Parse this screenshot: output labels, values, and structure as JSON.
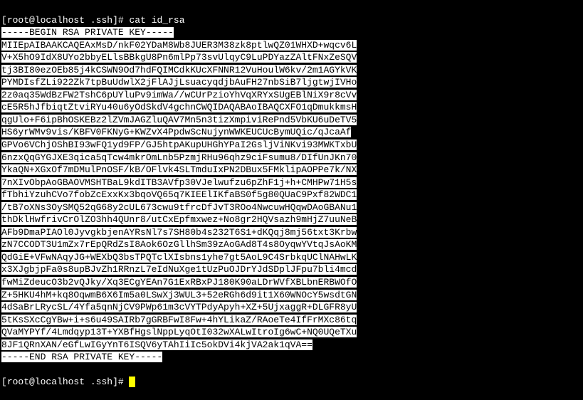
{
  "prompt1": {
    "bracket_open": "[",
    "user_host": "root@localhost",
    "path": ".ssh",
    "bracket_close": "]#",
    "command": "cat id_rsa"
  },
  "key": {
    "begin": "-----BEGIN RSA PRIVATE KEY-----",
    "lines": [
      "MIIEpAIBAAKCAQEAxMsD/nkF02YDaM8Wb8JUER3M38zk8ptlwQZ01WHXD+wqcv6L",
      "V+X5hO9IdX8UYo2bbyELlsBBkgU8Pn6mlPp73svUlqyC9LuPDYazZAltFNxZeSQV",
      "tj3BI80ezOEb85j4kCSWN9Od7hdFQIMCdkKUcXFNNR12VuHoulW6kv/2m1AGYkVK",
      "PYMDIsfZLi922Zk7tpBuUdwlX2jFlAJjLsuacyqdjbAuFH27nbSiB7ljgtwjIVHo",
      "2z0aq35WdBzFW2TshC6pUYluPv9imWa//wCUrPzioYhVqXRYxSUgEBlNiX9r8cVv",
      "cE5R5hJfbiqtZtviRYu40u6yOdSkdV4gchnCWQIDAQABAoIBAQCXFO1qDmukkmsH",
      "qgUlo+F6ipBhOSKEBz2lZVmJAGZluQAV7Mn5n3tizXmpiviRePnd5VbKU6uDeTV5",
      "HS6yrWMv9vis/KBFV0FKNyG+KWZvX4PpdwScNujynWWKEUCUcBymUQic/qJcaAf",
      "GPVo6VChjOShBI93wFQ1yd9FP/GJ5htpAKupUHGhYPaI2GsljViNKvi93MWKTxbU",
      "6nzxQqGYGJXE3qica5qTcw4mkrOmLnb5PzmjRHu96qhz9ciFsumu8/DIfUnJKn70",
      "YkaQN+XGxOf7mDMulPnOSF/kB/OFlvk4SLTmduIxPN2DBux5FMklipAOPPe7k/NX",
      "7nXIvObpAoGBAOVMSHTBaL9kdITB3AVfp30VJelwufzu6pZhF1j+h+CMHPw71H5s",
      "fTbhiYzuhCVo7fobZcExxKx3bqoVQ65q7KIEElIKfaBS0f5g80QUaC9Pxf82WDC1",
      "/tB7oXNs3OySMQ52qG68y2cUL673cwu9tfrcDfJvT3ROo4NwcuwHQqwDAoGBANu1",
      "thDklHwfrivCrOlZO3hh4QUnr8/utCxEpfmxwez+No8gr2HQVsazh9mHjZ7uuNeB",
      "AFb9DmaPIAOl0JyvgkbjenAYRsNl7s7SH80b4s232T6S1+dKQqj8mj56txt3Krbw",
      "zN7CCODT3U1mZx7rEpQRdZsI8Aok6OzGllhSm39zAoGAd8T4s8OyqwYVtqJsAoKM",
      "QdGiE+VFwNAqyJG+WEXbQ3bsTPQTclXIsbns1yhe7gt5AoL9C4SrbkqUClNAHwLK",
      "x3XJgbjpFa0s8upBJvZh1RRnzL7eIdNuXge1tUzPuOJDrYJdSDplJFpu7bli4mcd",
      "fwMiZdeucO3b2vQJky/Xq3ECgYEAn7G1ExRBxPJ180K90aLDrWVfXBLbnERBWOfO",
      "Z+5HKU4hM+kq8OqwmB6X6Im5a0LSwXj3WUL3+52eRGh6d9it1X60WNOcY5wsdtGN",
      "4dSaBrLRycSL/4Yfa5qnNjCV9PWp61m3cVYTPdyApyh+XZ+5UjxaggR+DLGFR8yU",
      "5tKsSXcCgYBw+i+s6u49SAIRb7gGRBFwI8Fw+4hYLikaZ/RAoeTe4IfFrMXc86tq",
      "QVaMYPYf/4Lmdqyp13T+YXBfHgslNppLyqOtI032wXALwItroIg6wC+NQ0UQeTXu",
      "8JF1QRnXAN/eGfLwIGyYnT6ISQV6yTAhIiIc5okDVi4kjVA2ak1qVA=="
    ],
    "end": "-----END RSA PRIVATE KEY-----"
  },
  "prompt2": {
    "bracket_open": "[",
    "user_host": "root@localhost",
    "path": ".ssh",
    "bracket_close": "]#"
  }
}
